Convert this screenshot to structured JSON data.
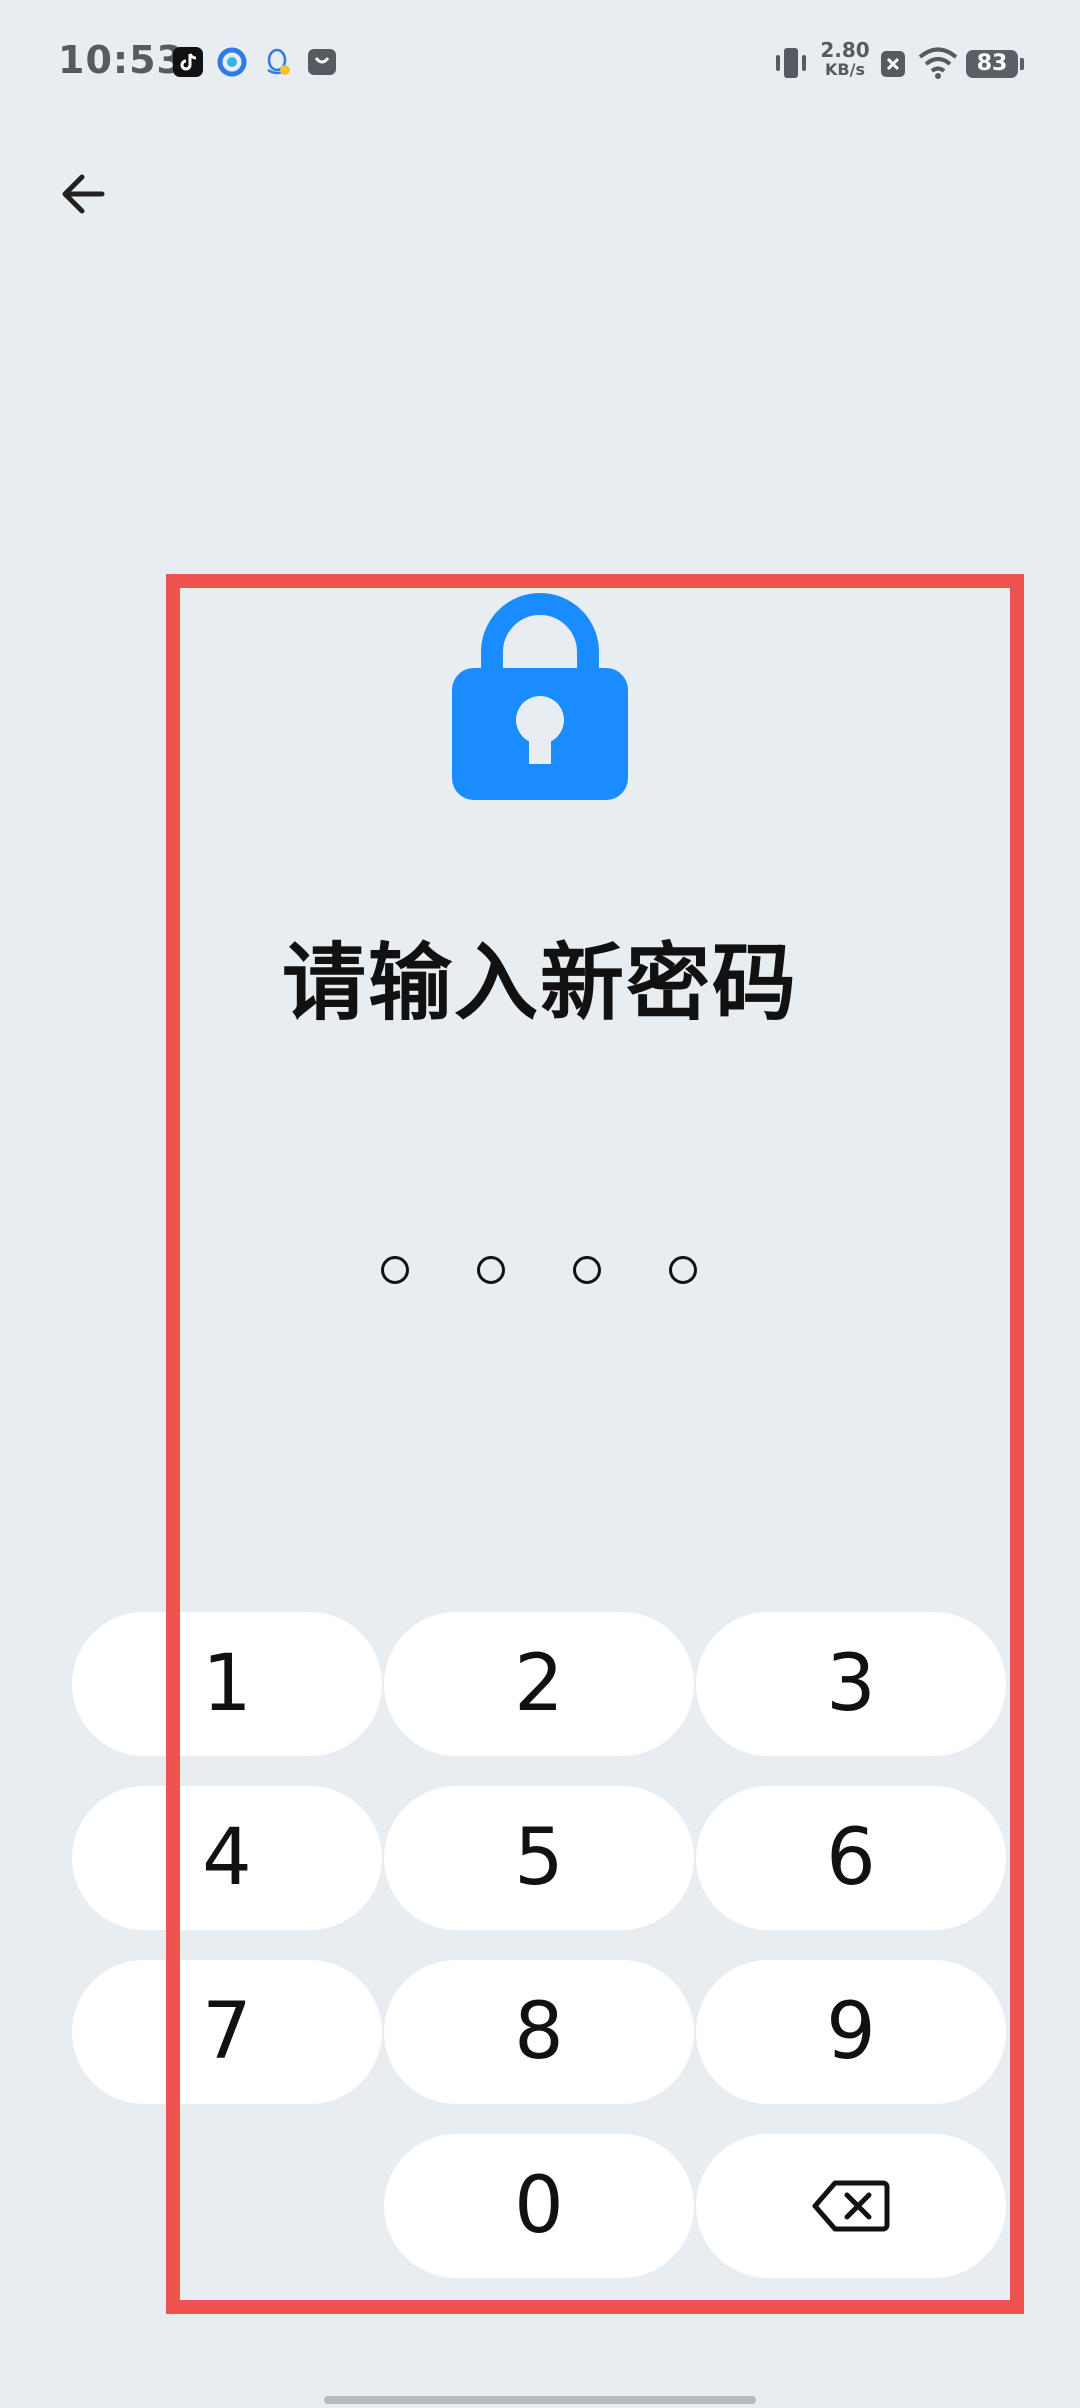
{
  "status_bar": {
    "time": "10:53",
    "net_speed_value": "2.80",
    "net_speed_unit": "KB/s",
    "battery": "83",
    "notification_icons": [
      "tiktok-icon",
      "browser-icon",
      "qq-icon",
      "store-icon"
    ],
    "system_icons": [
      "vibrate-icon",
      "no-sim-icon",
      "wifi-icon",
      "battery-icon"
    ]
  },
  "header": {
    "back_icon": "arrow-left-icon"
  },
  "lock": {
    "icon": "padlock-icon",
    "color": "#1a8cff"
  },
  "title": "请输入新密码",
  "pin": {
    "length": 4,
    "filled": 0
  },
  "keypad": {
    "keys": [
      "1",
      "2",
      "3",
      "4",
      "5",
      "6",
      "7",
      "8",
      "9",
      "0"
    ],
    "delete_icon": "backspace-icon"
  },
  "colors": {
    "background": "#e8edf2",
    "key_background": "#ffffff",
    "highlight": "#ef5350"
  }
}
